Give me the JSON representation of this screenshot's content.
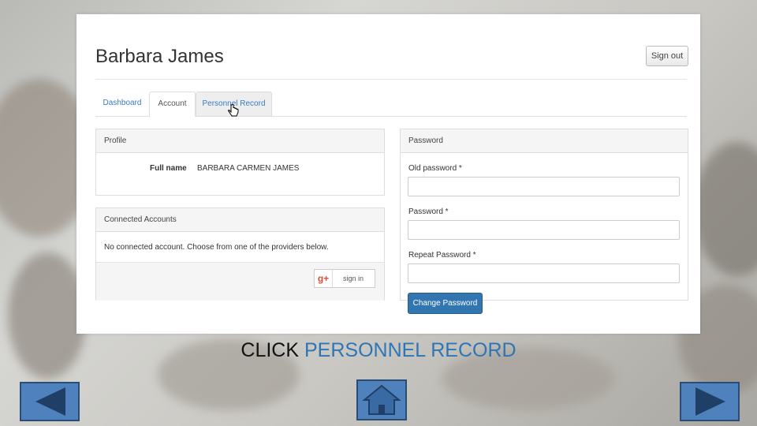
{
  "user": {
    "name": "Barbara James"
  },
  "header": {
    "signout_label": "Sign out"
  },
  "tabs": [
    {
      "label": "Dashboard"
    },
    {
      "label": "Account"
    },
    {
      "label": "Personnel Record"
    }
  ],
  "profile": {
    "title": "Profile",
    "fullname_label": "Full name",
    "fullname_value": "BARBARA CARMEN JAMES"
  },
  "connected": {
    "title": "Connected Accounts",
    "message": "No connected account. Choose from one of the providers below.",
    "signin_label": "sign in",
    "provider_icon": "google-plus-icon"
  },
  "password": {
    "title": "Password",
    "old_label": "Old password *",
    "new_label": "Password *",
    "repeat_label": "Repeat Password *",
    "button_label": "Change Password"
  },
  "instruction": {
    "word1": "CLICK",
    "word2": "PERSONNEL RECORD"
  },
  "nav": {
    "prev_icon": "left-arrow-icon",
    "home_icon": "home-icon",
    "next_icon": "right-arrow-icon"
  },
  "colors": {
    "accent": "#3276b1",
    "nav": "#4f81bd",
    "instruction_highlight": "#2e75b6"
  }
}
